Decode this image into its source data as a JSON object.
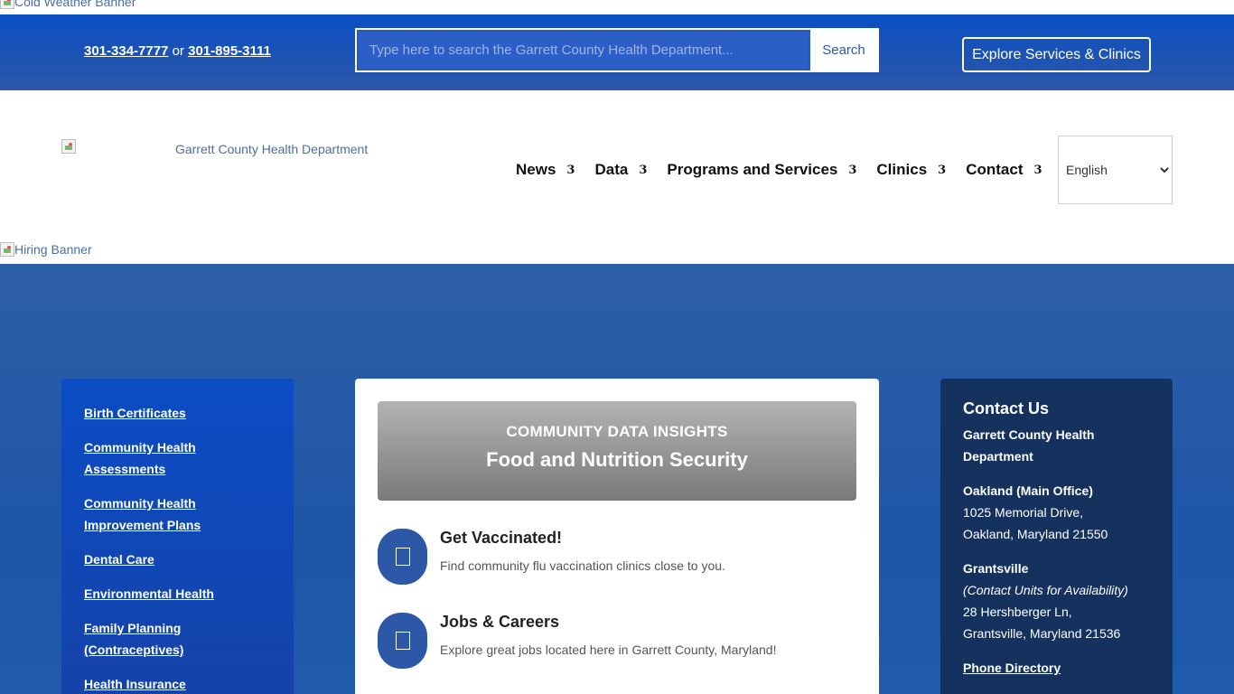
{
  "cold_banner": {
    "alt": "Cold Weather Banner"
  },
  "topbar": {
    "phone1": "301-334-7777",
    "or": "or",
    "phone2": "301-895-3111",
    "search_placeholder": "Type here to search the Garrett County Health Department...",
    "search_button": "Search",
    "explore_button": "Explore Services & Clinics"
  },
  "header": {
    "logo_alt": "Garrett County Health Department",
    "nav": [
      {
        "label": "News",
        "arrow": "3"
      },
      {
        "label": "Data",
        "arrow": "3"
      },
      {
        "label": "Programs and Services",
        "arrow": "3"
      },
      {
        "label": "Clinics",
        "arrow": "3"
      },
      {
        "label": "Contact",
        "arrow": "3"
      }
    ],
    "language": "English"
  },
  "hiring_banner": {
    "alt": "Hiring Banner"
  },
  "sidebar": {
    "links": [
      "Birth Certificates",
      "Community Health Assessments",
      "Community Health Improvement Plans",
      "Dental Care",
      "Environmental Health",
      "Family Planning (Contraceptives)",
      "Health Insurance"
    ]
  },
  "center": {
    "data_card": {
      "sup": "COMMUNITY DATA INSIGHTS",
      "title": "Food and Nutrition Security"
    },
    "features": [
      {
        "title": "Get Vaccinated!",
        "desc": "Find community flu vaccination clinics close to you.",
        "icon": "syringe-icon"
      },
      {
        "title": "Jobs & Careers",
        "desc": "Explore great jobs located here in Garrett County, Maryland!",
        "icon": "briefcase-icon"
      }
    ]
  },
  "contact": {
    "heading": "Contact Us",
    "org": "Garrett County Health Department",
    "main_office_label": "Oakland (Main Office)",
    "main_office_addr1": "1025 Memorial Drive,",
    "main_office_addr2": "Oakland, Maryland 21550",
    "grantsville_label": "Grantsville",
    "grantsville_note": "(Contact Units for Availability)",
    "grantsville_addr1": "28 Hershberger Ln,",
    "grantsville_addr2": "Grantsville, Maryland 21536",
    "phone_directory": "Phone Directory"
  },
  "colors": {
    "topbar": "#0a4fc4",
    "main_bg": "#2d5fa8",
    "contact_bg": "#15325e",
    "feature_circle": "#2d58a8"
  }
}
